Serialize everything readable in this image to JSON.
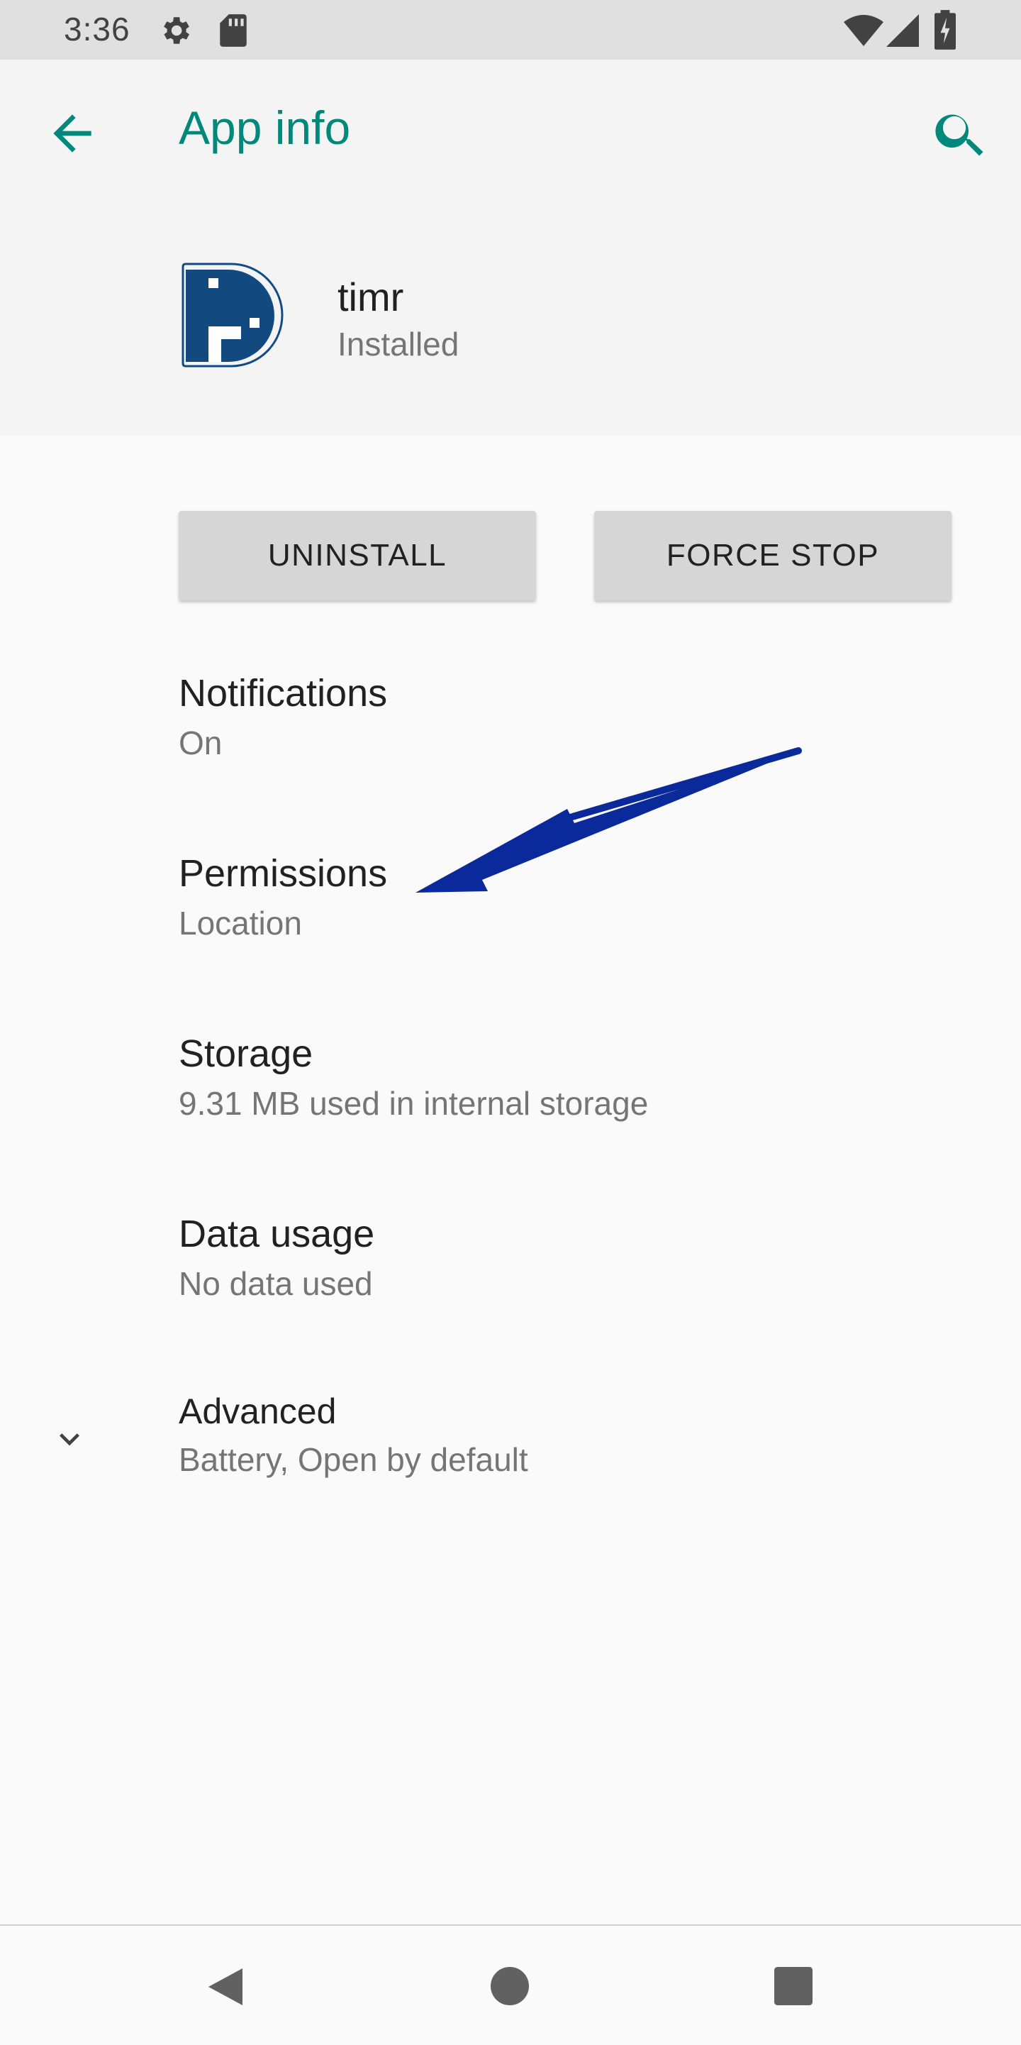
{
  "status_bar": {
    "time": "3:36",
    "icons": [
      "gear-icon",
      "sd-card-icon",
      "wifi-icon",
      "signal-icon",
      "battery-charging-icon"
    ]
  },
  "header": {
    "title": "App info",
    "back_icon": "arrow-left-icon",
    "search_icon": "search-icon"
  },
  "app": {
    "name": "timr",
    "status": "Installed",
    "icon": "timr-logo-icon"
  },
  "buttons": {
    "uninstall": "UNINSTALL",
    "force_stop": "FORCE STOP"
  },
  "settings": [
    {
      "title": "Notifications",
      "subtitle": "On"
    },
    {
      "title": "Permissions",
      "subtitle": "Location"
    },
    {
      "title": "Storage",
      "subtitle": "9.31 MB used in internal storage"
    },
    {
      "title": "Data usage",
      "subtitle": "No data used"
    },
    {
      "title": "Advanced",
      "subtitle": "Battery, Open by default",
      "expand_icon": "chevron-down-icon"
    }
  ],
  "annotation": {
    "icon": "annotation-arrow",
    "color": "#0a2a9c"
  },
  "nav": [
    "back-triangle-icon",
    "home-circle-icon",
    "recents-square-icon"
  ],
  "colors": {
    "accent": "#00897b",
    "header_bg": "#f4f4f4",
    "button_bg": "#d6d6d6",
    "status_bar_bg": "#e0e0e0"
  }
}
